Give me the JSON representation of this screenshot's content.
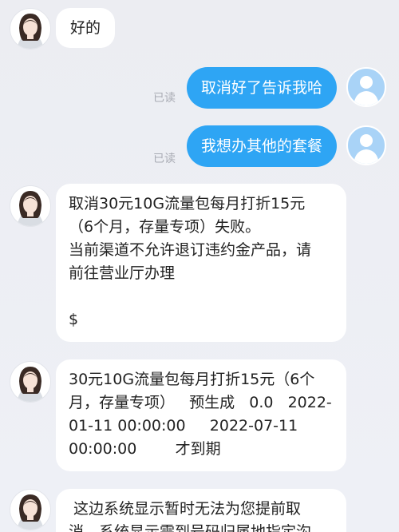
{
  "messages": [
    {
      "from": "agent",
      "lines": [
        "好的"
      ]
    },
    {
      "from": "user",
      "text": "取消好了告诉我哈",
      "status": "已读"
    },
    {
      "from": "user",
      "text": "我想办其他的套餐",
      "status": "已读"
    },
    {
      "from": "agent",
      "lines": [
        "取消30元10G流量包每月打折15元",
        "（6个月，存量专项）失败。",
        "当前渠道不允许退订违约金产品，请",
        "前往营业厅办理",
        "",
        "$"
      ]
    },
    {
      "from": "agent",
      "lines": [
        "30元10G流量包每月打折15元（6个",
        "月，存量专项）   预生成   0.0   2022-",
        "01-11 00:00:00     2022-07-11",
        "00:00:00        才到期"
      ]
    },
    {
      "from": "agent",
      "lines": [
        " 这边系统显示暂时无法为您提前取",
        "消，系统显示需到号码归属地指定沟"
      ]
    }
  ],
  "colors": {
    "user_bubble": "#2ea5f4",
    "agent_bubble": "#ffffff",
    "read_status": "#a8abb3"
  },
  "icons": {
    "agent_avatar": "agent-avatar-icon",
    "user_avatar": "user-avatar-icon"
  }
}
